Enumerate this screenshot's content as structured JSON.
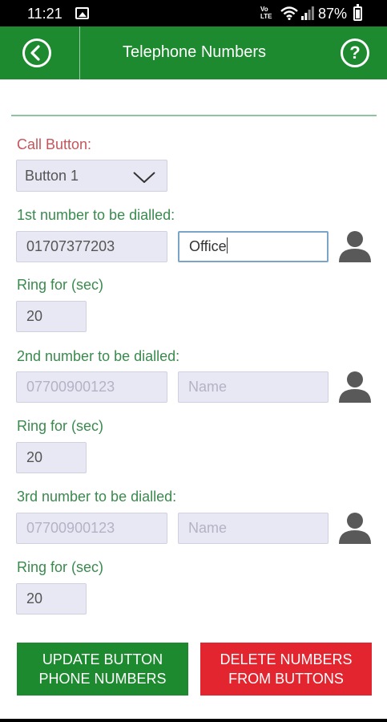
{
  "status": {
    "time": "11:21",
    "volte": "VoLTE",
    "battery": "87%"
  },
  "header": {
    "title": "Telephone Numbers",
    "help_glyph": "?"
  },
  "form": {
    "call_button_label": "Call Button:",
    "call_button_value": "Button 1",
    "entries": [
      {
        "label": "1st number to be dialled:",
        "number_value": "01707377203",
        "name_value": "Office",
        "ring_label": "Ring for (sec)",
        "ring_value": "20"
      },
      {
        "label": "2nd number to be dialled:",
        "number_placeholder": "07700900123",
        "name_placeholder": "Name",
        "ring_label": "Ring for (sec)",
        "ring_value": "20"
      },
      {
        "label": "3rd number to be dialled:",
        "number_placeholder": "07700900123",
        "name_placeholder": "Name",
        "ring_label": "Ring for (sec)",
        "ring_value": "20"
      }
    ]
  },
  "actions": {
    "update_label": "UPDATE BUTTON\nPHONE NUMBERS",
    "delete_label": "DELETE NUMBERS\nFROM BUTTONS"
  },
  "colors": {
    "brand_green": "#1d8a2f",
    "label_green": "#3a8a4e",
    "label_red": "#c2565c",
    "delete_red": "#e3252f"
  },
  "icons": [
    "back-arrow-icon",
    "help-icon",
    "contact-icon",
    "chevron-down-icon",
    "gallery-icon",
    "wifi-icon",
    "signal-icon",
    "battery-icon"
  ]
}
